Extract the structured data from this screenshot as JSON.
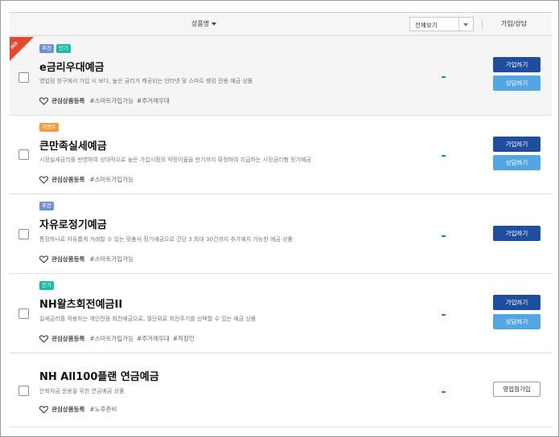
{
  "header": {
    "product_name": "상품명",
    "filter_value": "전체보기",
    "join_consult": "가입/상담"
  },
  "colors": {
    "join": "#1f4e9e",
    "consult": "#54a6e2",
    "hit": "#e8452e",
    "dash": "#2a7ad8"
  },
  "products": [
    {
      "hit_label": "Hit",
      "badges": [
        "추천",
        "인기"
      ],
      "title": "e금리우대예금",
      "desc": "영업점 창구에서 가입 시 보다, 높은 금리가 제공되는 인터넷 및 스마트 뱅킹 전용 예금 상품",
      "fav": "관심상품등록",
      "tags": [
        "#스마트가입가능",
        "#주거래우대"
      ],
      "rate": "-",
      "join_label": "가입하기",
      "consult_label": "상담하기"
    },
    {
      "badges": [
        "이벤트"
      ],
      "title": "큰만족실세예금",
      "desc": "시장실세금리를 반영하여 상대적으로 높은 가입시점의 약정이율을 만기까지 확정하여 지급하는 시장금리형 정기예금",
      "fav": "관심상품등록",
      "tags": [
        "#스마트가입가능"
      ],
      "rate": "-",
      "join_label": "가입하기",
      "consult_label": "상담하기"
    },
    {
      "badges": [
        "추천"
      ],
      "title": "자유로정기예금",
      "desc": "통장하나로 자유롭게 거래할 수 있는 맞춤식 정기예금으로 건당 3 최대 30건까지 추가예치 가능한 예금 상품",
      "fav": "관심상품등록",
      "tags": [
        "#스마트가입가능"
      ],
      "rate": "-",
      "join_label": "가입하기"
    },
    {
      "badges": [
        "인기"
      ],
      "title": "NH왈츠회전예금II",
      "desc": "실세금리를 적용하는 개인전용 회전예금으로, 월단위로 회전주기를 선택할 수 있는 예금 상품",
      "fav": "관심상품등록",
      "tags": [
        "#스마트가입가능",
        "#주거래우대",
        "#직장인"
      ],
      "rate": "-",
      "join_label": "가입하기",
      "consult_label": "상담하기"
    },
    {
      "badges": [],
      "title": "NH All100플랜 연금예금",
      "desc": "은퇴자금 운용을 위한 연금예금 상품",
      "fav": "관심상품등록",
      "tags": [
        "#노후준비"
      ],
      "rate": "-",
      "branch_label": "영업점가입"
    }
  ]
}
